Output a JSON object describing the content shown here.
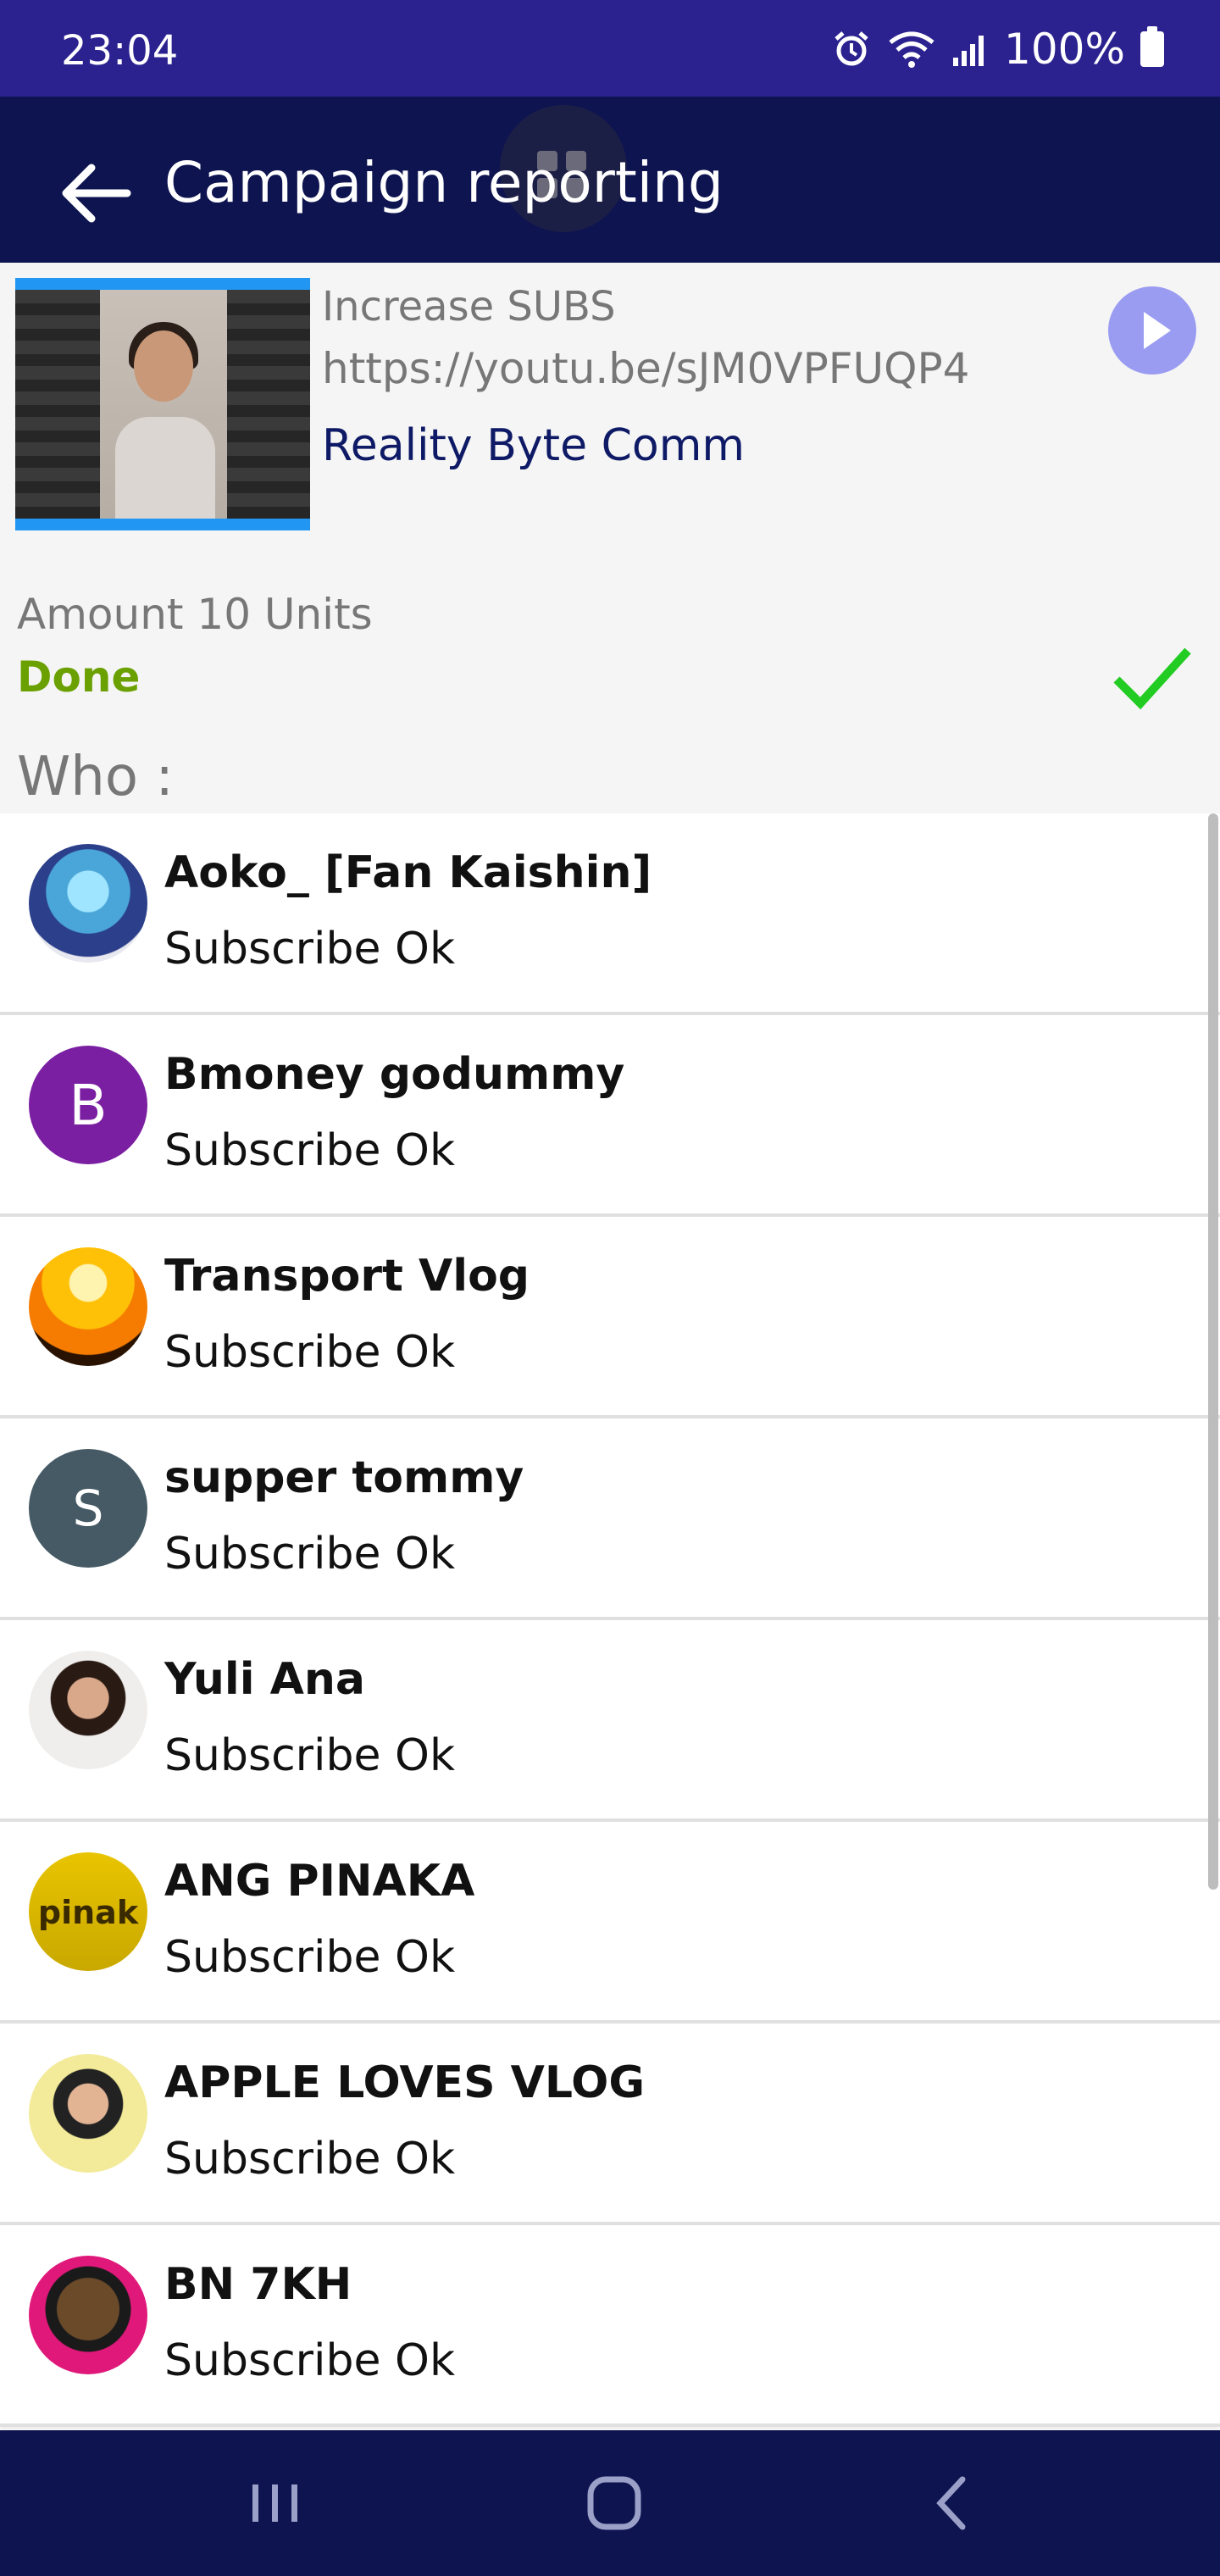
{
  "status_bar": {
    "time": "23:04",
    "battery": "100%"
  },
  "app_bar": {
    "title": "Campaign reporting"
  },
  "campaign": {
    "type": "Increase SUBS",
    "url": "https://youtu.be/sJM0VPFUQP4",
    "channel": "Reality Byte Comm",
    "amount": "Amount 10 Units",
    "status": "Done",
    "who_label": "Who :"
  },
  "subscribers": [
    {
      "name": "Aoko_ [Fan Kaishin]",
      "status": "Subscribe Ok",
      "avatar": "photo"
    },
    {
      "name": "Bmoney godummy",
      "status": "Subscribe Ok",
      "avatar": "B",
      "color": "#7b1fa2"
    },
    {
      "name": "Transport Vlog",
      "status": "Subscribe Ok",
      "avatar": "photo"
    },
    {
      "name": "supper tommy",
      "status": "Subscribe Ok",
      "avatar": "S",
      "color": "#455a64"
    },
    {
      "name": "Yuli Ana",
      "status": "Subscribe Ok",
      "avatar": "photo"
    },
    {
      "name": "ANG PINAKA",
      "status": "Subscribe Ok",
      "avatar": "photo"
    },
    {
      "name": "APPLE LOVES VLOG",
      "status": "Subscribe Ok",
      "avatar": "photo"
    },
    {
      "name": "BN 7KH",
      "status": "Subscribe Ok",
      "avatar": "photo"
    }
  ],
  "colors": {
    "status_bar": "#2b2290",
    "app_bar": "#0e1450",
    "done": "#6aa000",
    "check": "#22cc22",
    "play": "#9a9cf2"
  }
}
